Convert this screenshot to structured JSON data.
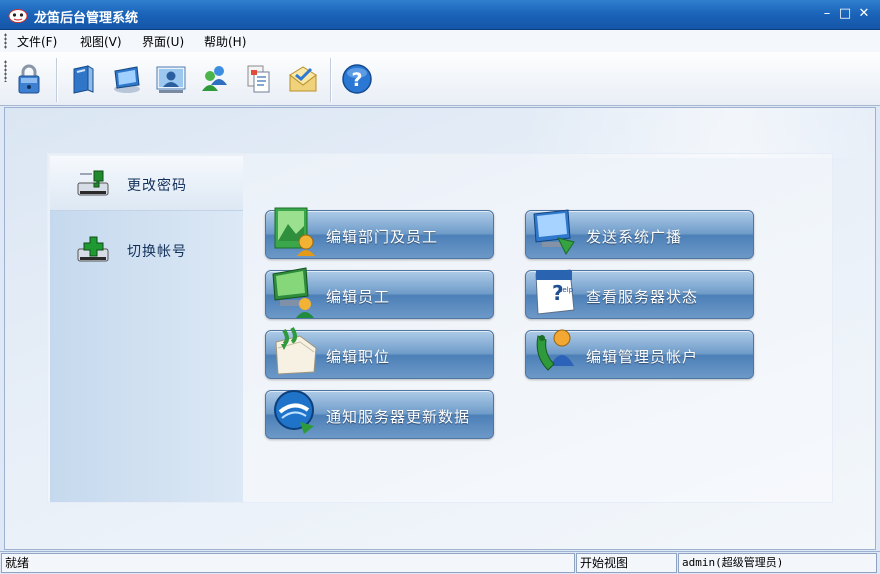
{
  "window": {
    "title": "龙笛后台管理系统",
    "controls": {
      "minimize": "–",
      "maximize": "□",
      "close": "✕"
    }
  },
  "menu": [
    {
      "label": "文件(F)"
    },
    {
      "label": "视图(V)"
    },
    {
      "label": "界面(U)"
    },
    {
      "label": "帮助(H)"
    }
  ],
  "toolbar": {
    "buttons": [
      {
        "name": "lock-icon"
      },
      {
        "name": "book-icon"
      },
      {
        "name": "monitor-icon"
      },
      {
        "name": "user-card-icon"
      },
      {
        "name": "users-icon"
      },
      {
        "name": "documents-icon"
      },
      {
        "name": "mail-icon"
      },
      {
        "name": "help-icon"
      }
    ]
  },
  "sidebar": {
    "items": [
      {
        "label": "更改密码",
        "icon": "key-drive-icon",
        "active": true
      },
      {
        "label": "切换帐号",
        "icon": "add-drive-icon",
        "active": false
      }
    ]
  },
  "functions": {
    "left": [
      {
        "label": "编辑部门及员工",
        "icon": "department-icon"
      },
      {
        "label": "编辑员工",
        "icon": "employee-icon"
      },
      {
        "label": "编辑职位",
        "icon": "position-folder-icon"
      },
      {
        "label": "通知服务器更新数据",
        "icon": "server-update-icon"
      }
    ],
    "right": [
      {
        "label": "发送系统广播",
        "icon": "broadcast-icon"
      },
      {
        "label": "查看服务器状态",
        "icon": "server-status-icon"
      },
      {
        "label": "编辑管理员帐户",
        "icon": "admin-account-icon"
      }
    ]
  },
  "statusbar": {
    "status": "就绪",
    "view": "开始视图",
    "user": "admin(超级管理员)"
  },
  "colors": {
    "titlebar": "#1a63b8",
    "button_gradient_top": "#aecbe8",
    "button_gradient_bottom": "#4d80b8"
  }
}
